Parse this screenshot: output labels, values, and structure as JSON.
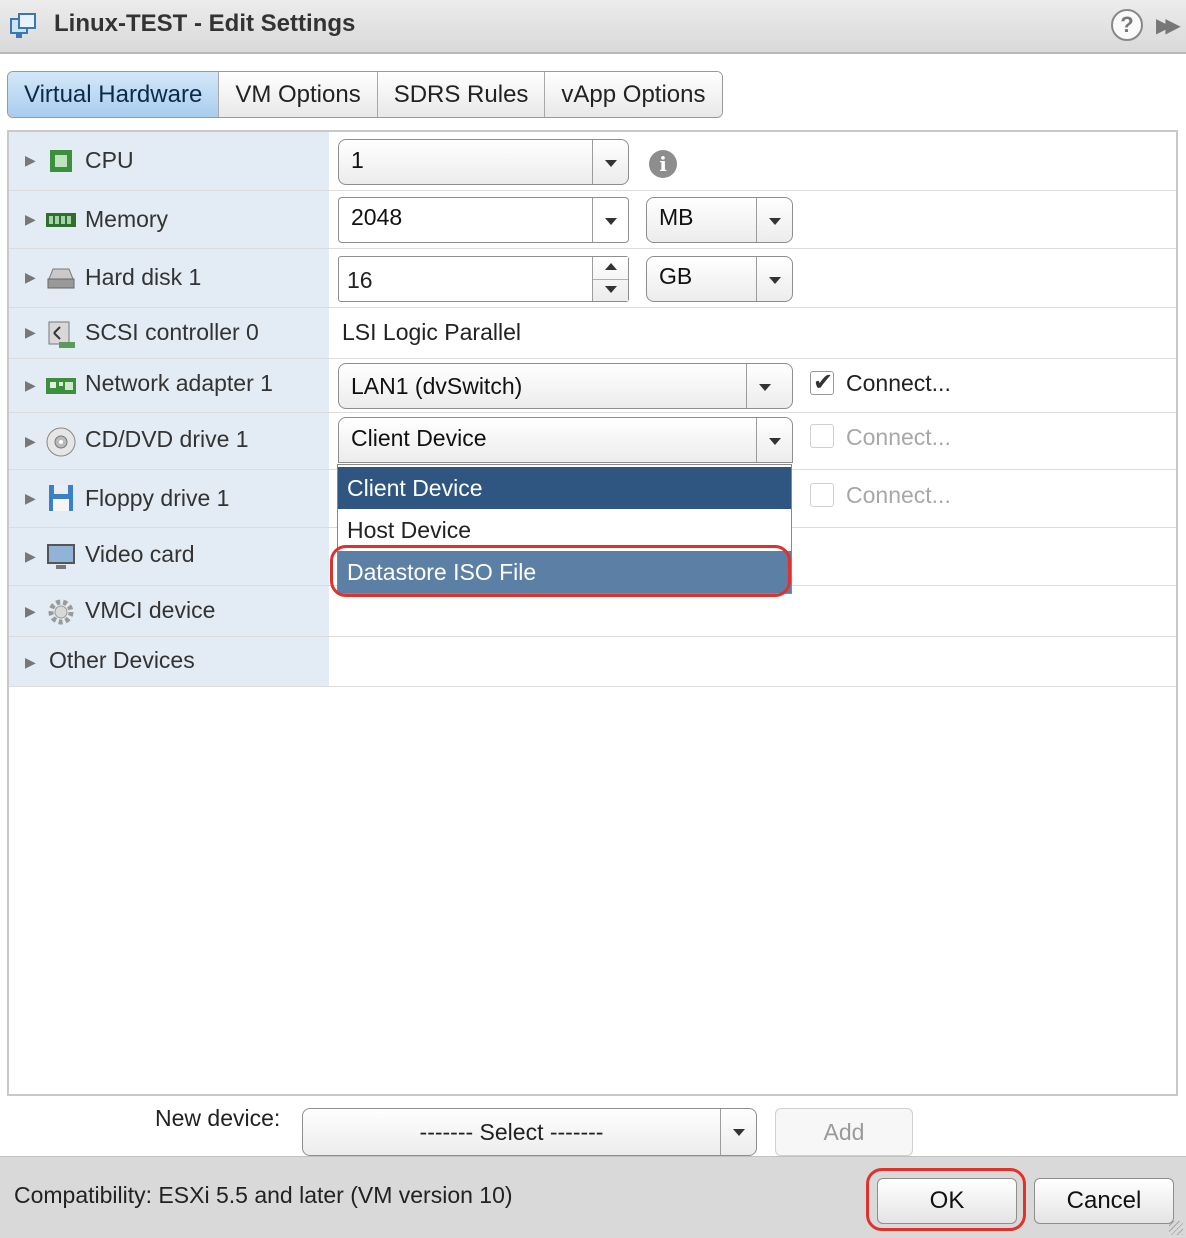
{
  "window": {
    "title": "Linux-TEST - Edit Settings",
    "help_label": "?"
  },
  "tabs": [
    {
      "label": "Virtual Hardware",
      "active": true
    },
    {
      "label": "VM Options"
    },
    {
      "label": "SDRS Rules"
    },
    {
      "label": "vApp Options"
    }
  ],
  "devices": {
    "cpu": {
      "label": "CPU",
      "icon": "cpu-icon",
      "value": "1"
    },
    "memory": {
      "label": "Memory",
      "icon": "memory-icon",
      "value": "2048",
      "unit": "MB"
    },
    "hard_disk": {
      "label": "Hard disk 1",
      "icon": "hard-disk-icon",
      "value": "16",
      "unit": "GB"
    },
    "scsi": {
      "label": "SCSI controller 0",
      "icon": "scsi-controller-icon",
      "value": "LSI Logic Parallel"
    },
    "network": {
      "label": "Network adapter 1",
      "icon": "network-adapter-icon",
      "value": "LAN1 (dvSwitch)",
      "connect_label": "Connect...",
      "connected": true
    },
    "cdrom": {
      "label": "CD/DVD drive 1",
      "icon": "cd-dvd-icon",
      "value": "Client Device",
      "connect_label": "Connect...",
      "connected": false
    },
    "floppy": {
      "label": "Floppy drive 1",
      "icon": "floppy-icon",
      "connect_label": "Connect...",
      "connected": false
    },
    "video": {
      "label": "Video card",
      "icon": "monitor-icon"
    },
    "vmci": {
      "label": "VMCI device",
      "icon": "gear-icon"
    },
    "other": {
      "label": "Other Devices"
    }
  },
  "cd_dropdown": {
    "options": [
      "Client Device",
      "Host Device",
      "Datastore ISO File"
    ],
    "selected": "Client Device",
    "hovered": "Datastore ISO File"
  },
  "new_device": {
    "label": "New device:",
    "select_value": "------- Select -------",
    "add_label": "Add"
  },
  "footer": {
    "compatibility": "Compatibility: ESXi 5.5 and later (VM version 10)",
    "ok_label": "OK",
    "cancel_label": "Cancel"
  },
  "colors": {
    "accent": "#2f5680",
    "hover": "#5c7fa6",
    "highlight": "#e0322a",
    "label_bg": "#e3ecf4"
  }
}
